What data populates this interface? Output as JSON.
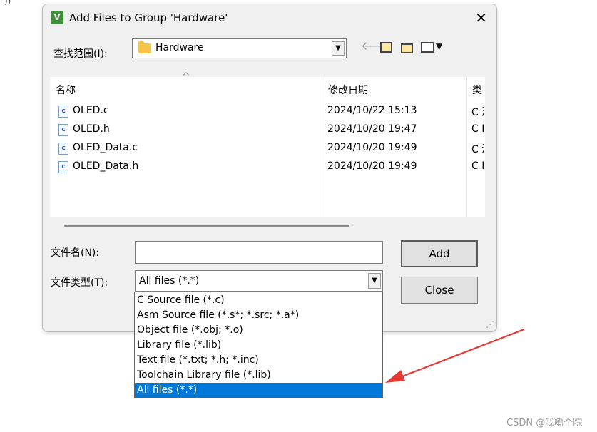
{
  "window": {
    "title": "Add Files to Group 'Hardware'",
    "app_icon": "V",
    "close_glyph": "✕"
  },
  "lookin": {
    "label": "查找范围(I):",
    "value": "Hardware"
  },
  "toolbar": {
    "back_icon": "arrow-left-icon",
    "up_icon": "folder-up-icon",
    "new_icon": "new-folder-icon",
    "view_icon": "view-menu-icon"
  },
  "filelist": {
    "columns": [
      "名称",
      "修改日期",
      "类"
    ],
    "rows": [
      {
        "name": "OLED.c",
        "date": "2024/10/22 15:13",
        "type": "C 源"
      },
      {
        "name": "OLED.h",
        "date": "2024/10/20 19:47",
        "type": "C I"
      },
      {
        "name": "OLED_Data.c",
        "date": "2024/10/20 19:49",
        "type": "C 源"
      },
      {
        "name": "OLED_Data.h",
        "date": "2024/10/20 19:49",
        "type": "C I"
      }
    ]
  },
  "filename": {
    "label": "文件名(N):",
    "value": ""
  },
  "filetype": {
    "label": "文件类型(T):",
    "value": "All files (*.*)",
    "options": [
      "C Source file (*.c)",
      "Asm Source file (*.s*; *.src; *.a*)",
      "Object file (*.obj; *.o)",
      "Library file (*.lib)",
      "Text file (*.txt; *.h; *.inc)",
      "Toolchain Library file (*.lib)",
      "All files (*.*)"
    ],
    "selected_index": 6
  },
  "buttons": {
    "add": "Add",
    "close": "Close"
  },
  "annotation": {
    "arrow_color": "#e53935"
  },
  "watermark": "CSDN @我嘞个院",
  "colors": {
    "selection": "#0078d7"
  }
}
